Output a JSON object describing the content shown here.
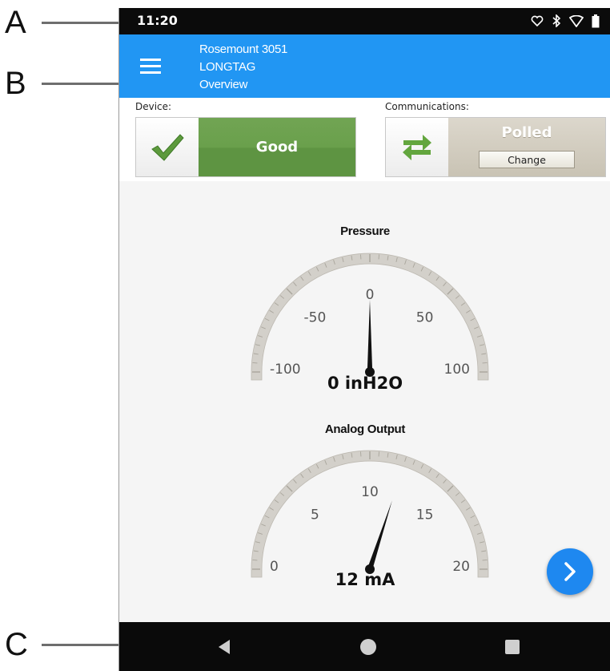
{
  "callouts": {
    "a": "A",
    "b": "B",
    "c": "C"
  },
  "status_bar": {
    "time": "11:20",
    "icons": [
      "heart-outline-icon",
      "bluetooth-icon",
      "wifi-icon",
      "battery-icon"
    ]
  },
  "app_bar": {
    "menu_icon": "hamburger-menu-icon",
    "device_model": "Rosemount 3051",
    "tag": "LONGTAG",
    "page": "Overview",
    "color": "#2196f3"
  },
  "device": {
    "label": "Device:",
    "status": "Good",
    "icon": "checkmark-icon",
    "status_color": "#6aa04c"
  },
  "communications": {
    "label": "Communications:",
    "status": "Polled",
    "change_label": "Change",
    "icon": "swap-arrows-icon"
  },
  "gauges": [
    {
      "title": "Pressure",
      "ticks": [
        "-100",
        "-50",
        "0",
        "50",
        "100"
      ],
      "min": -100,
      "max": 100,
      "value": 0,
      "value_label": "0 inH2O"
    },
    {
      "title": "Analog Output",
      "ticks": [
        "0",
        "5",
        "10",
        "15",
        "20"
      ],
      "min": 0,
      "max": 20,
      "value": 12,
      "value_label": "12 mA"
    }
  ],
  "fab": {
    "icon": "chevron-right-icon",
    "color": "#1e88f0"
  },
  "nav_bar": {
    "buttons": [
      "back-triangle-icon",
      "home-circle-icon",
      "recents-square-icon"
    ]
  }
}
